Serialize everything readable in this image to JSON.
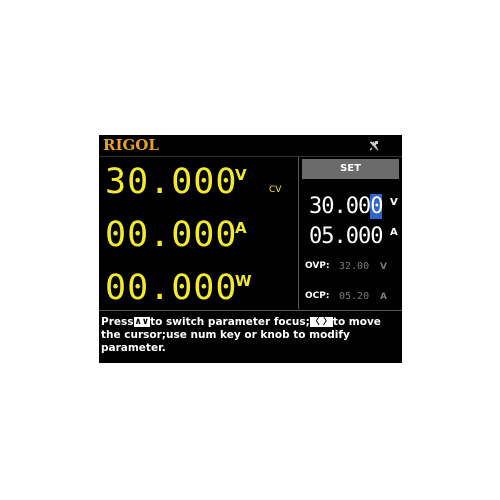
{
  "brand": "RIGOL",
  "status_icons": [
    "usb-disconnected-icon"
  ],
  "colors": {
    "display_bg": "#000000",
    "measure_yellow": "#f2ea2a",
    "brand_orange": "#e8a02a",
    "set_button": "#6b6b6b",
    "cursor_blue": "#2f66c9",
    "disabled_gray": "#7a7a7a"
  },
  "measure": {
    "voltage": "30.000",
    "voltage_unit": "V",
    "current": "00.000",
    "current_unit": "A",
    "power": "00.000",
    "power_unit": "W",
    "mode": "CV"
  },
  "settings": {
    "button_label": "SET",
    "voltage_prefix": "30.00",
    "voltage_cursor_digit": "0",
    "voltage_unit": "V",
    "current": "05.000",
    "current_unit": "A",
    "ovp_label": "OVP:",
    "ovp_value": "32.00",
    "ovp_unit": "V",
    "ocp_label": "OCP:",
    "ocp_value": "05.20",
    "ocp_unit": "A"
  },
  "help": {
    "part1": "Press",
    "keys_updown": "∧∨",
    "part2": "to switch parameter focus;",
    "keys_leftright": "〈 〉",
    "part3": "to move the cursor;use num key or knob to modify parameter."
  }
}
